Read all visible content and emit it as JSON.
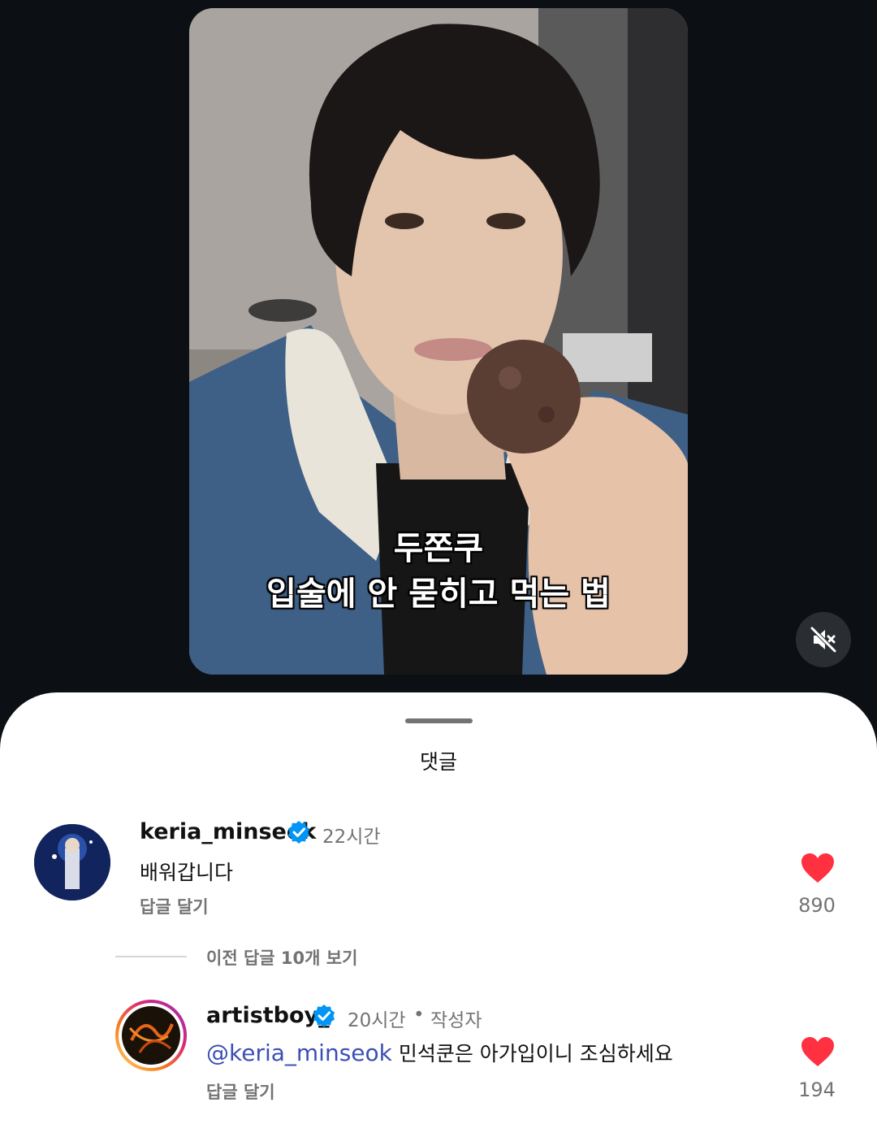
{
  "video": {
    "caption_line1": "두쫀쿠",
    "caption_line2": "입술에 안 묻히고 먹는 법",
    "mute_icon": "speaker-muted-icon"
  },
  "sheet": {
    "title": "댓글"
  },
  "comments": [
    {
      "username": "keria_minseok",
      "verified": true,
      "time": "22시간",
      "text": "배워갑니다",
      "reply_label": "답글 달기",
      "likes": "890",
      "liked": true
    }
  ],
  "view_more_label": "이전 답글 10개 보기",
  "replies": [
    {
      "username": "artistboy_",
      "verified": true,
      "time": "20시간",
      "dot": "•",
      "author_label": "작성자",
      "mention": "@keria_minseok",
      "text": "민석쿤은 아가입이니 조심하세요",
      "reply_label": "답글 달기",
      "likes": "194",
      "liked": true
    }
  ],
  "colors": {
    "background": "#0c1014",
    "heart": "#ff3040",
    "verified": "#0095f6",
    "mention": "#3b4fb4"
  }
}
